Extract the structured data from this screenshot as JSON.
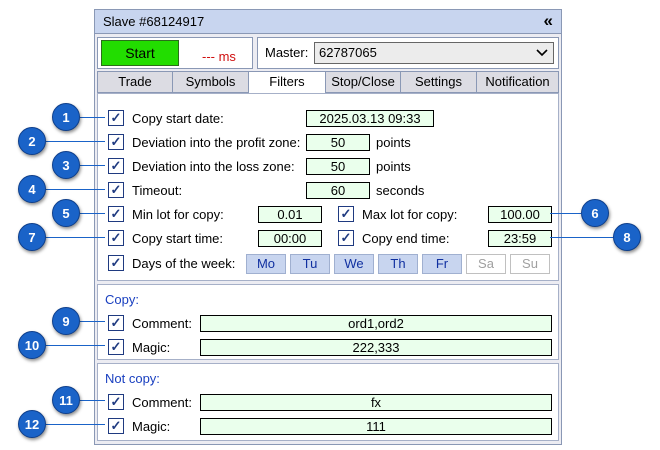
{
  "window": {
    "title": "Slave #68124917",
    "collapse_icon": "double-chevron-left-icon"
  },
  "start": {
    "button_label": "Start",
    "latency": "--- ms"
  },
  "master": {
    "label": "Master:",
    "value": "62787065"
  },
  "tabs": [
    {
      "label": "Trade"
    },
    {
      "label": "Symbols"
    },
    {
      "label": "Filters",
      "active": true
    },
    {
      "label": "Stop/Close"
    },
    {
      "label": "Settings"
    },
    {
      "label": "Notification"
    }
  ],
  "filters": {
    "copy_start_date": {
      "label": "Copy start date:",
      "value": "2025.03.13 09:33"
    },
    "deviation_profit": {
      "label": "Deviation into the profit zone:",
      "value": "50",
      "unit": "points"
    },
    "deviation_loss": {
      "label": "Deviation into the loss zone:",
      "value": "50",
      "unit": "points"
    },
    "timeout": {
      "label": "Timeout:",
      "value": "60",
      "unit": "seconds"
    },
    "min_lot": {
      "label": "Min lot for copy:",
      "value": "0.01"
    },
    "max_lot": {
      "label": "Max lot for copy:",
      "value": "100.00"
    },
    "copy_start_time": {
      "label": "Copy start time:",
      "value": "00:00"
    },
    "copy_end_time": {
      "label": "Copy end time:",
      "value": "23:59"
    },
    "days": {
      "label": "Days of the week:",
      "items": [
        {
          "label": "Mo",
          "on": true
        },
        {
          "label": "Tu",
          "on": true
        },
        {
          "label": "We",
          "on": true
        },
        {
          "label": "Th",
          "on": true
        },
        {
          "label": "Fr",
          "on": true
        },
        {
          "label": "Sa",
          "on": false
        },
        {
          "label": "Su",
          "on": false
        }
      ]
    }
  },
  "copy": {
    "title": "Copy:",
    "comment": {
      "label": "Comment:",
      "value": "ord1,ord2"
    },
    "magic": {
      "label": "Magic:",
      "value": "222,333"
    }
  },
  "not_copy": {
    "title": "Not copy:",
    "comment": {
      "label": "Comment:",
      "value": "fx"
    },
    "magic": {
      "label": "Magic:",
      "value": "111"
    }
  },
  "checkbox_mark": "✓",
  "callouts": [
    "1",
    "2",
    "3",
    "4",
    "5",
    "6",
    "7",
    "8",
    "9",
    "10",
    "11",
    "12"
  ],
  "colors": {
    "accent": "#1a63c8",
    "start": "#22dd00",
    "latency": "#d01010",
    "section_title": "#1a40c0",
    "field_bg": "#eaffec"
  }
}
